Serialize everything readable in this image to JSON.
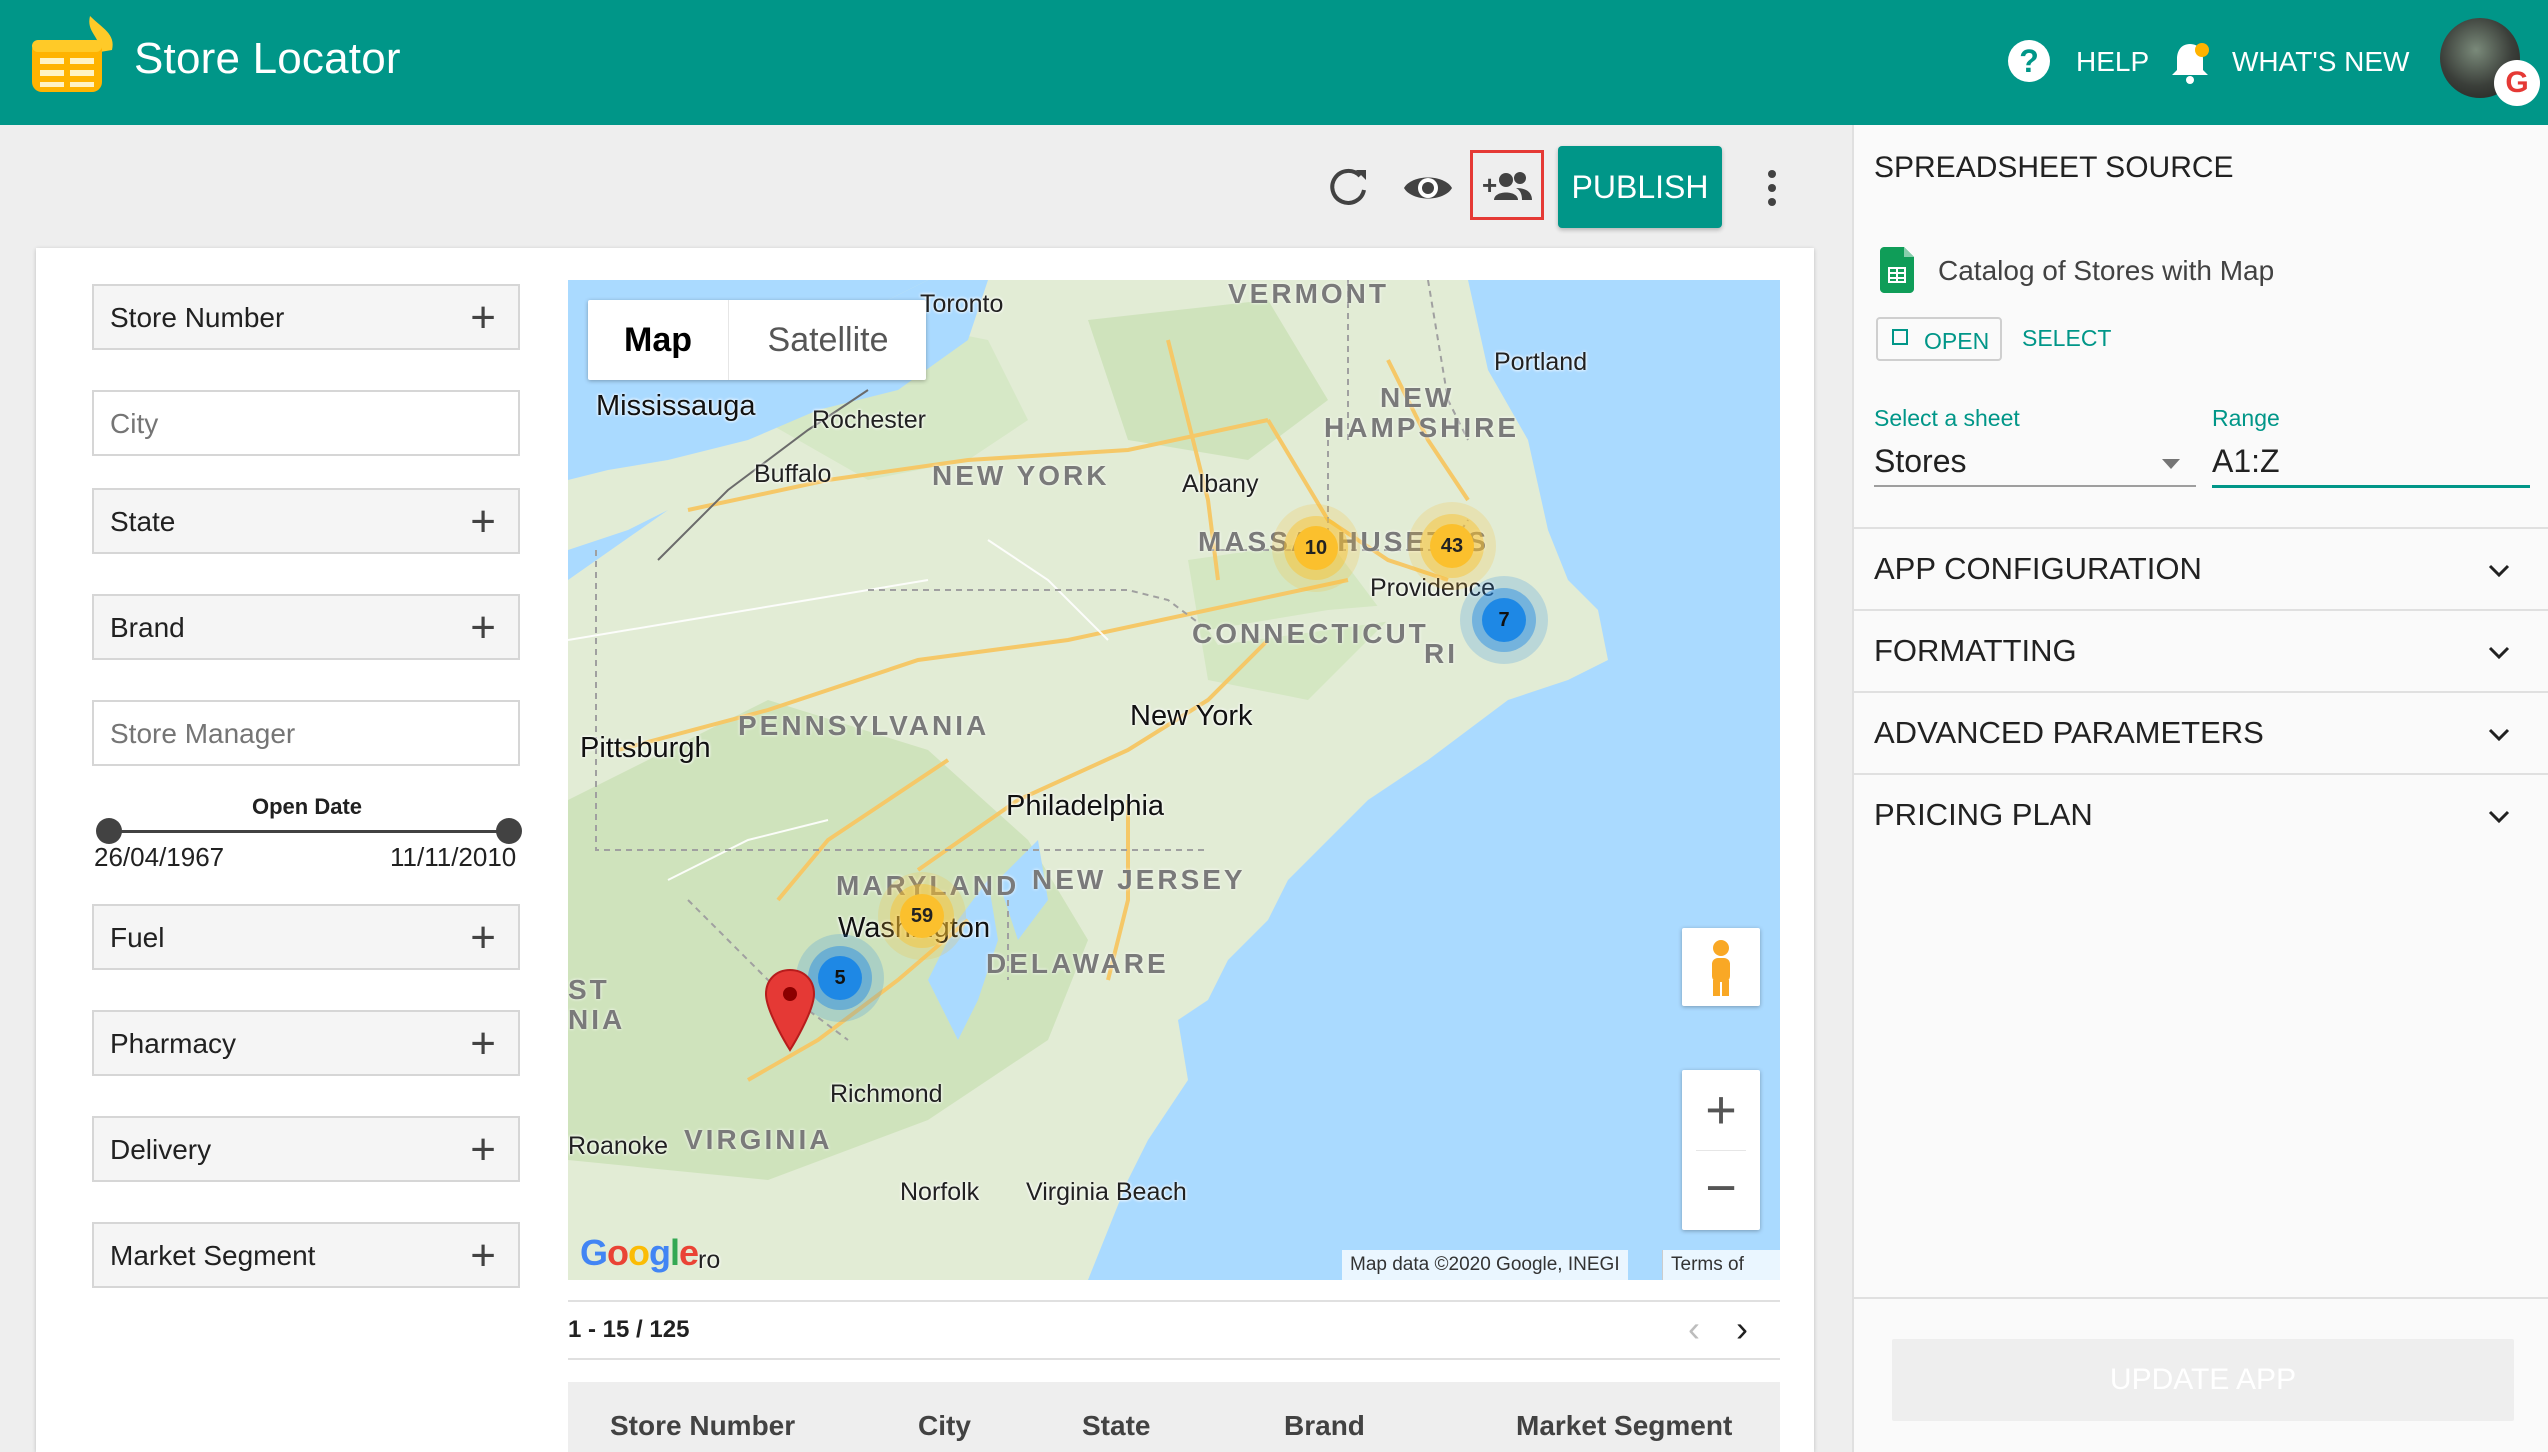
{
  "app": {
    "title": "Store Locator"
  },
  "header": {
    "help": "HELP",
    "whats_new": "WHAT'S NEW",
    "avatar_badge": "G"
  },
  "toolbar": {
    "publish": "PUBLISH"
  },
  "filters": {
    "store_number": "Store Number",
    "city": "City",
    "state": "State",
    "brand": "Brand",
    "store_manager": "Store Manager",
    "fuel": "Fuel",
    "pharmacy": "Pharmacy",
    "delivery": "Delivery",
    "market_segment": "Market Segment",
    "plus": "+"
  },
  "open_date": {
    "title": "Open Date",
    "start": "26/04/1967",
    "end": "11/11/2010"
  },
  "map": {
    "type_map": "Map",
    "type_satellite": "Satellite",
    "zoom_in": "+",
    "zoom_out": "−",
    "google": "Google",
    "attribution": "Map data ©2020 Google, INEGI",
    "terms": "Terms of Use",
    "labels": {
      "vermont": "VERMONT",
      "toronto": "Toronto",
      "mississauga": "Mississauga",
      "rochester": "Rochester",
      "buffalo": "Buffalo",
      "new_york_state": "NEW YORK",
      "albany": "Albany",
      "portland": "Portland",
      "new_hampshire": "NEW HAMPSHIRE",
      "massachusetts": "MASSACHUSETTS",
      "providence": "Providence",
      "connecticut": "CONNECTICUT",
      "ri": "RI",
      "pennsylvania": "PENNSYLVANIA",
      "pittsburgh": "Pittsburgh",
      "new_york_city": "New York",
      "philadelphia": "Philadelphia",
      "maryland": "MARYLAND",
      "new_jersey": "NEW JERSEY",
      "washington": "Washington",
      "delaware": "DELAWARE",
      "west_virginia_1": "ST",
      "west_virginia_2": "NIA",
      "richmond": "Richmond",
      "roanoke": "Roanoke",
      "virginia": "VIRGINIA",
      "norfolk": "Norfolk",
      "virginia_beach": "Virginia Beach",
      "boro": "ro"
    },
    "clusters": {
      "c10": "10",
      "c43": "43",
      "c7": "7",
      "c59": "59",
      "c5": "5"
    }
  },
  "pager": {
    "count": "1 - 15 / 125",
    "prev": "‹",
    "next": "›"
  },
  "table": {
    "columns": [
      "Store Number",
      "City",
      "State",
      "Brand",
      "Market Segment"
    ]
  },
  "panel": {
    "title": "SPREADSHEET SOURCE",
    "sheet_name": "Catalog of Stores with Map",
    "open": "OPEN",
    "select": "SELECT",
    "sheet_label": "Select a sheet",
    "sheet_value": "Stores",
    "range_label": "Range",
    "range_value": "A1:Z",
    "sections": [
      "APP CONFIGURATION",
      "FORMATTING",
      "ADVANCED PARAMETERS",
      "PRICING PLAN"
    ],
    "update": "UPDATE APP"
  },
  "colors": {
    "primary": "#009688",
    "cluster_yellow": "#fbc02d",
    "cluster_blue": "#1e88e5",
    "highlight": "#e53935"
  }
}
